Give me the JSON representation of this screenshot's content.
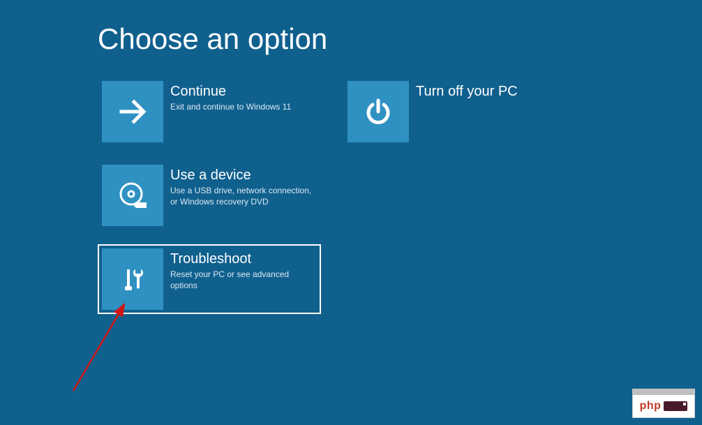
{
  "title": "Choose an option",
  "options": {
    "continue": {
      "title": "Continue",
      "desc": "Exit and continue to Windows 11"
    },
    "use_device": {
      "title": "Use a device",
      "desc": "Use a USB drive, network connection, or Windows recovery DVD"
    },
    "troubleshoot": {
      "title": "Troubleshoot",
      "desc": "Reset your PC or see advanced options"
    },
    "turn_off": {
      "title": "Turn off your PC",
      "desc": ""
    }
  },
  "watermark": {
    "text": "php"
  }
}
